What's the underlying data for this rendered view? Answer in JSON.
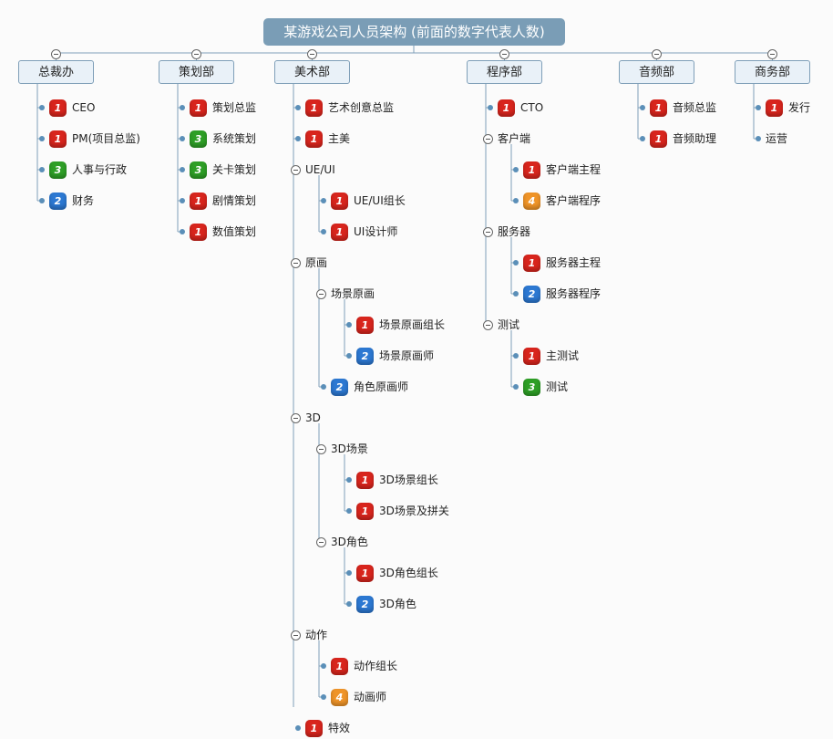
{
  "title": "某游戏公司人员架构 (前面的数字代表人数)",
  "colors": {
    "red": "#d8251d",
    "green": "#2e9f26",
    "blue": "#2c78d2",
    "orange": "#ef9428"
  },
  "departments": [
    {
      "label": "总裁办",
      "items": [
        {
          "label": "CEO",
          "count": "1"
        },
        {
          "label": "PM(项目总监)",
          "count": "1"
        },
        {
          "label": "人事与行政",
          "count": "3"
        },
        {
          "label": "财务",
          "count": "2"
        }
      ]
    },
    {
      "label": "策划部",
      "items": [
        {
          "label": "策划总监",
          "count": "1"
        },
        {
          "label": "系统策划",
          "count": "3"
        },
        {
          "label": "关卡策划",
          "count": "3"
        },
        {
          "label": "剧情策划",
          "count": "1"
        },
        {
          "label": "数值策划",
          "count": "1"
        }
      ]
    },
    {
      "label": "美术部",
      "items": [
        {
          "label": "艺术创意总监",
          "count": "1"
        },
        {
          "label": "主美",
          "count": "1"
        },
        {
          "label": "UE/UI",
          "children": [
            {
              "label": "UE/UI组长",
              "count": "1"
            },
            {
              "label": "UI设计师",
              "count": "1"
            }
          ]
        },
        {
          "label": "原画",
          "children": [
            {
              "label": "场景原画",
              "children": [
                {
                  "label": "场景原画组长",
                  "count": "1"
                },
                {
                  "label": "场景原画师",
                  "count": "2"
                }
              ]
            },
            {
              "label": "角色原画师",
              "count": "2"
            }
          ]
        },
        {
          "label": "3D",
          "children": [
            {
              "label": "3D场景",
              "children": [
                {
                  "label": "3D场景组长",
                  "count": "1"
                },
                {
                  "label": "3D场景及拼关",
                  "count": "1"
                }
              ]
            },
            {
              "label": "3D角色",
              "children": [
                {
                  "label": "3D角色组长",
                  "count": "1"
                },
                {
                  "label": "3D角色",
                  "count": "2"
                }
              ]
            }
          ]
        },
        {
          "label": "动作",
          "children": [
            {
              "label": "动作组长",
              "count": "1"
            },
            {
              "label": "动画师",
              "count": "4"
            }
          ]
        },
        {
          "label": "特效",
          "count": "1"
        }
      ]
    },
    {
      "label": "程序部",
      "items": [
        {
          "label": "CTO",
          "count": "1"
        },
        {
          "label": "客户端",
          "children": [
            {
              "label": "客户端主程",
              "count": "1"
            },
            {
              "label": "客户端程序",
              "count": "4"
            }
          ]
        },
        {
          "label": "服务器",
          "children": [
            {
              "label": "服务器主程",
              "count": "1"
            },
            {
              "label": "服务器程序",
              "count": "2"
            }
          ]
        },
        {
          "label": "测试",
          "children": [
            {
              "label": "主测试",
              "count": "1"
            },
            {
              "label": "测试",
              "count": "3"
            }
          ]
        }
      ]
    },
    {
      "label": "音频部",
      "items": [
        {
          "label": "音频总监",
          "count": "1"
        },
        {
          "label": "音频助理",
          "count": "1"
        }
      ]
    },
    {
      "label": "商务部",
      "items": [
        {
          "label": "发行",
          "count": "1"
        },
        {
          "label": "运营"
        }
      ]
    }
  ]
}
